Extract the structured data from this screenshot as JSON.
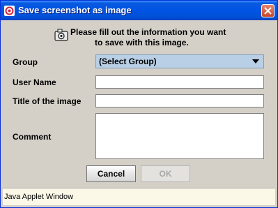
{
  "window": {
    "title": "Save screenshot as image",
    "icon": "app-logo-icon",
    "close_icon": "close-icon"
  },
  "form": {
    "message_line1": "Please fill out the information you want",
    "message_line2": "to save with this image.",
    "message_icon": "camera-icon",
    "group_label": "Group",
    "group_selected": "(Select Group)",
    "user_name_label": "User Name",
    "user_name_value": "",
    "title_label": "Title of the image",
    "title_value": "",
    "comment_label": "Comment",
    "comment_value": ""
  },
  "buttons": {
    "cancel_label": "Cancel",
    "ok_label": "OK",
    "ok_enabled": false
  },
  "status": {
    "text": "Java Applet Window"
  },
  "colors": {
    "titlebar": "#0054e3",
    "panel": "#d4d0c8",
    "close_button": "#c8452a",
    "select_bg": "#b8cfe5",
    "status_bg": "#fbf8e8"
  }
}
